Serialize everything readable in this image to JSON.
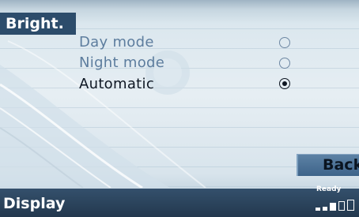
{
  "menu": {
    "title": "Bright."
  },
  "options": [
    {
      "label": "Day mode",
      "selected": false
    },
    {
      "label": "Night mode",
      "selected": false
    },
    {
      "label": "Automatic",
      "selected": true
    }
  ],
  "back_button": {
    "label": "Back"
  },
  "statusbar": {
    "title": "Display",
    "status": "Ready",
    "signal_level": "3 of 5 bars"
  },
  "colors": {
    "accent": "#2c4c6b",
    "inactive_text": "#5d7d9e",
    "active_text": "#0d1622",
    "statusbar": "#23384e"
  },
  "icons": {
    "radio_unselected": "radio-unselected-icon",
    "radio_selected": "radio-selected-icon",
    "signal": "signal-strength-icon"
  }
}
